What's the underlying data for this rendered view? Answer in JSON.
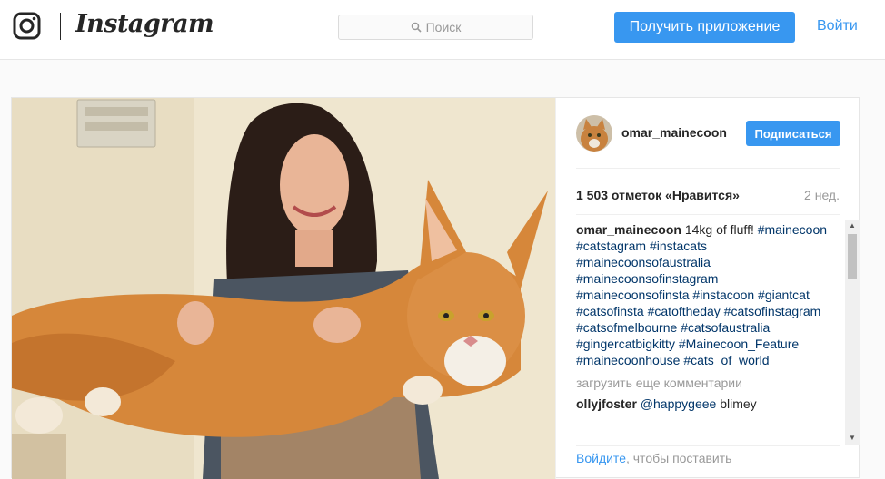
{
  "header": {
    "brand": "Instagram",
    "search_placeholder": "Поиск",
    "get_app_label": "Получить приложение",
    "login_label": "Войти"
  },
  "colors": {
    "accent": "#3897f0",
    "hashtag": "#003569",
    "muted": "#999999"
  },
  "post": {
    "username": "omar_mainecoon",
    "follow_label": "Подписаться",
    "likes": "1 503 отметок «Нравится»",
    "time": "2 нед.",
    "caption": {
      "username": "omar_mainecoon",
      "text": "14kg of fluff!",
      "hashtags": [
        "#mainecoon",
        "#catstagram",
        "#instacats",
        "#mainecoonsofaustralia",
        "#mainecoonsofinstagram",
        "#mainecoonsofinsta",
        "#instacoon",
        "#giantcat",
        "#catsofinsta",
        "#catoftheday",
        "#catsofinstagram",
        "#catsofmelbourne",
        "#catsofaustralia",
        "#gingercatbigkitty",
        "#Mainecoon_Feature",
        "#mainecoonhouse",
        "#cats_of_world"
      ]
    },
    "load_more_label": "загрузить еще комментарии",
    "comments": [
      {
        "username": "ollyjfoster",
        "mention": "@happygeee",
        "text": "blimey"
      }
    ],
    "login_prompt": {
      "link": "Войдите",
      "text": ", чтобы поставить"
    }
  }
}
